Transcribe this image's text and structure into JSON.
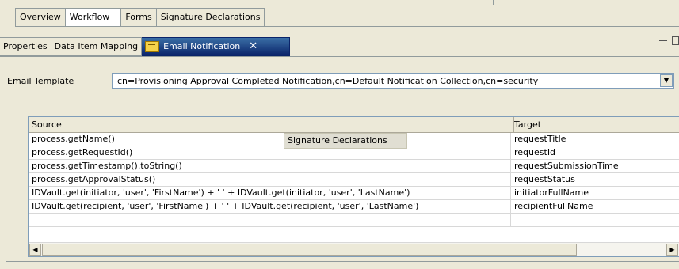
{
  "editor_tabs": [
    "Overview",
    "Workflow",
    "Forms",
    "Signature Declarations"
  ],
  "active_editor_tab": "Workflow",
  "view_tabs": {
    "properties": "Properties",
    "data_item_mapping": "Data Item Mapping",
    "email_notification": "Email Notification",
    "close_glyph": "✕"
  },
  "email_template": {
    "label": "Email Template",
    "value": "cn=Provisioning Approval Completed Notification,cn=Default Notification Collection,cn=security"
  },
  "table": {
    "headers": {
      "source": "Source",
      "target": "Target"
    },
    "rows": [
      {
        "source": "process.getName()",
        "target": "requestTitle"
      },
      {
        "source": "process.getRequestId()",
        "target": "requestId"
      },
      {
        "source": "process.getTimestamp().toString()",
        "target": "requestSubmissionTime"
      },
      {
        "source": "process.getApprovalStatus()",
        "target": "requestStatus"
      },
      {
        "source": "IDVault.get(initiator, 'user', 'FirstName') + ' ' + IDVault.get(initiator, 'user', 'LastName')",
        "target": "initiatorFullName"
      },
      {
        "source": "IDVault.get(recipient, 'user', 'FirstName') + ' ' + IDVault.get(recipient, 'user', 'LastName')",
        "target": "recipientFullName"
      }
    ]
  },
  "tooltip": "Signature Declarations",
  "icons": {
    "email_notification": "mail-icon",
    "dropdown": "chevron-down-icon",
    "scroll_left": "arrow-left-icon",
    "scroll_right": "arrow-right-icon",
    "minimize": "minimize-icon",
    "maximize": "maximize-icon"
  },
  "colors": {
    "active_tab": "#0a246a",
    "background": "#ece9d8",
    "border": "#919b9c"
  }
}
